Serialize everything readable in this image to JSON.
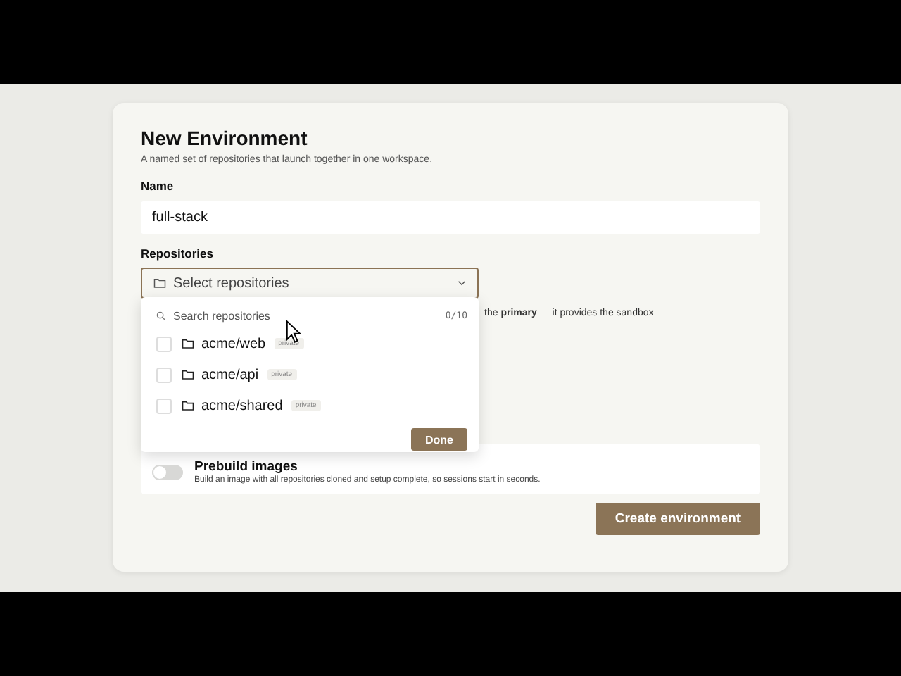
{
  "dialog": {
    "title": "New Environment",
    "subtitle": "A named set of repositories that launch together in one workspace.",
    "name_field": {
      "label": "Name",
      "value": "full-stack"
    },
    "repositories": {
      "label": "Repositories",
      "placeholder": "Select repositories",
      "hint": "the **primary** — it provides the sandbox",
      "dropdown": {
        "search_placeholder": "Search repositories",
        "count": "0/10",
        "items": [
          {
            "name": "acme/web",
            "badge": "private",
            "checked": false
          },
          {
            "name": "acme/api",
            "badge": "private",
            "checked": false
          },
          {
            "name": "acme/shared",
            "badge": "private",
            "checked": false
          }
        ],
        "done_button": "Done"
      }
    },
    "prebuild": {
      "title": "Prebuild images",
      "description": "Build an image with all repositories cloned and setup complete, so sessions start in seconds.",
      "on": false
    },
    "create_button": "Create environment"
  }
}
